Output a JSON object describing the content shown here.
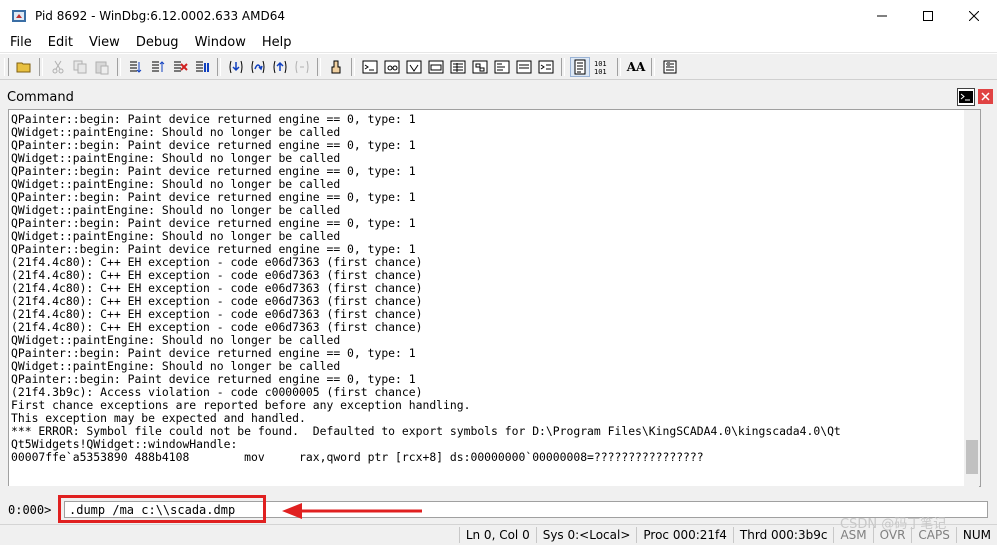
{
  "window": {
    "title": "Pid 8692 - WinDbg:6.12.0002.633 AMD64",
    "minimize_glyph": "—",
    "maximize_glyph": "☐",
    "close_glyph": "✕"
  },
  "menu": {
    "items": [
      "File",
      "Edit",
      "View",
      "Debug",
      "Window",
      "Help"
    ]
  },
  "toolbar": {
    "buttons": [
      "open-icon",
      "cut-icon",
      "copy-icon",
      "paste-icon",
      "go-icon",
      "restart-icon",
      "stop-debugging-icon",
      "break-icon",
      "step-into-icon",
      "step-over-icon",
      "step-out-icon",
      "run-to-cursor-icon",
      "source-mode-icon",
      "command-window-icon",
      "watch-icon",
      "locals-icon",
      "registers-icon",
      "memory-icon",
      "call-stack-icon",
      "disassembly-icon",
      "scratch-pad-icon",
      "processes-threads-icon",
      "source-mode-on-icon",
      "hex-mode-icon",
      "font-icon",
      "options-icon"
    ],
    "font_label": "AA"
  },
  "command_window": {
    "title": "Command",
    "output_lines": [
      "QPainter::begin: Paint device returned engine == 0, type: 1",
      "QWidget::paintEngine: Should no longer be called",
      "QPainter::begin: Paint device returned engine == 0, type: 1",
      "QWidget::paintEngine: Should no longer be called",
      "QPainter::begin: Paint device returned engine == 0, type: 1",
      "QWidget::paintEngine: Should no longer be called",
      "QPainter::begin: Paint device returned engine == 0, type: 1",
      "QWidget::paintEngine: Should no longer be called",
      "QPainter::begin: Paint device returned engine == 0, type: 1",
      "QWidget::paintEngine: Should no longer be called",
      "QPainter::begin: Paint device returned engine == 0, type: 1",
      "(21f4.4c80): C++ EH exception - code e06d7363 (first chance)",
      "(21f4.4c80): C++ EH exception - code e06d7363 (first chance)",
      "(21f4.4c80): C++ EH exception - code e06d7363 (first chance)",
      "(21f4.4c80): C++ EH exception - code e06d7363 (first chance)",
      "(21f4.4c80): C++ EH exception - code e06d7363 (first chance)",
      "(21f4.4c80): C++ EH exception - code e06d7363 (first chance)",
      "QWidget::paintEngine: Should no longer be called",
      "QPainter::begin: Paint device returned engine == 0, type: 1",
      "QWidget::paintEngine: Should no longer be called",
      "QPainter::begin: Paint device returned engine == 0, type: 1",
      "(21f4.3b9c): Access violation - code c0000005 (first chance)",
      "First chance exceptions are reported before any exception handling.",
      "This exception may be expected and handled.",
      "*** ERROR: Symbol file could not be found.  Defaulted to export symbols for D:\\Program Files\\KingSCADA4.0\\kingscada4.0\\Qt",
      "Qt5Widgets!QWidget::windowHandle:",
      "00007ffe`a5353890 488b4108        mov     rax,qword ptr [rcx+8] ds:00000000`00000008=????????????????"
    ],
    "prompt": "0:000>",
    "input_value": ".dump /ma c:\\\\scada.dmp"
  },
  "statusbar": {
    "position": "Ln 0, Col 0",
    "sys": "Sys 0:<Local>",
    "proc": "Proc 000:21f4",
    "thrd": "Thrd 000:3b9c",
    "asm": "ASM",
    "ovr": "OVR",
    "caps": "CAPS",
    "num": "NUM"
  },
  "watermark": "CSDN @码丁笔记",
  "colors": {
    "highlight": "#e02020",
    "close_button": "#e04343"
  }
}
